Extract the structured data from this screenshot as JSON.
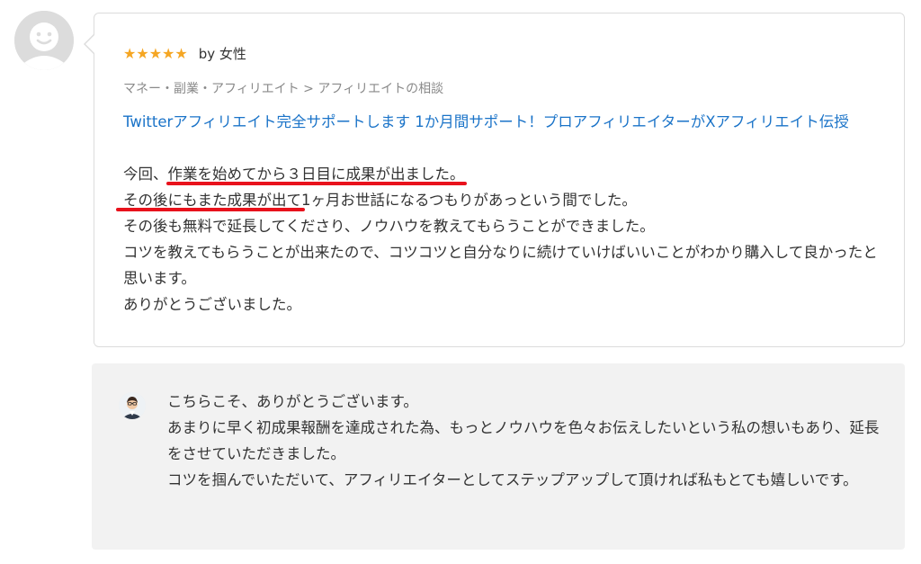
{
  "reviewer": {
    "avatar_icon": "default-user-avatar-icon"
  },
  "review": {
    "stars": "★★★★★",
    "rating": 5,
    "by": "by 女性",
    "category": "マネー・副業・アフィリエイト > アフィリエイトの相談",
    "service_title": "Twitterアフィリエイト完全サポートします 1か月間サポート！プロアフィリエイターがXアフィリエイト伝授",
    "line1_prefix": "今回、",
    "line1_highlight": "作業を始めてから３日目に成果が出ました。",
    "line2_highlight": "その後にもまた成果が出て",
    "line2_rest": "1ヶ月お世話になるつもりがあっという間でした。",
    "line3": "その後も無料で延長してくださり、ノウハウを教えてもらうことができました。",
    "line4": "コツを教えてもらうことが出来たので、コツコツと自分なりに続けていけばいいことがわかり購入して良かったと思います。",
    "line5": "ありがとうございました。"
  },
  "reply": {
    "avatar_icon": "seller-avatar-icon",
    "line1": "こちらこそ、ありがとうございます。",
    "line2": "あまりに早く初成果報酬を達成された為、もっとノウハウを色々お伝えしたいという私の想いもあり、延長をさせていただきました。",
    "line3": "コツを掴んでいただいて、アフィリエイターとしてステップアップして頂ければ私もとても嬉しいです。"
  },
  "colors": {
    "star": "#f5a623",
    "link": "#1a73c8",
    "underline": "#e8121c",
    "reply_bg": "#f2f2f2"
  }
}
